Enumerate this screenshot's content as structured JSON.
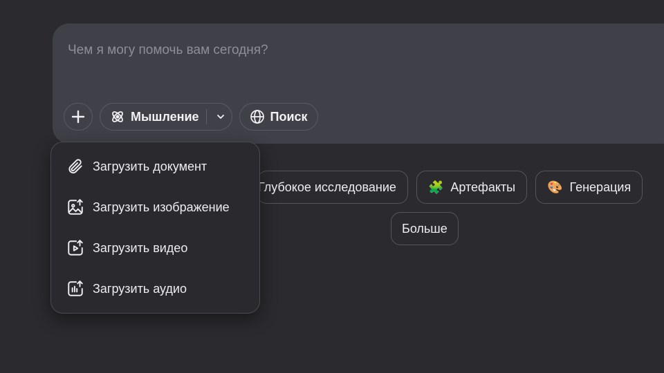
{
  "composer": {
    "placeholder": "Чем я могу помочь вам сегодня?",
    "thinking_label": "Мышление",
    "search_label": "Поиск"
  },
  "menu": {
    "items": [
      {
        "label": "Загрузить документ",
        "icon": "paperclip-icon"
      },
      {
        "label": "Загрузить изображение",
        "icon": "image-upload-icon"
      },
      {
        "label": "Загрузить видео",
        "icon": "video-upload-icon"
      },
      {
        "label": "Загрузить аудио",
        "icon": "audio-upload-icon"
      }
    ]
  },
  "suggestions": {
    "items": [
      {
        "label": "Глубокое исследование"
      },
      {
        "label": "Артефакты",
        "icon": "🧩"
      },
      {
        "label": "Генерация",
        "icon": "🎨"
      }
    ],
    "more_label": "Больше"
  }
}
